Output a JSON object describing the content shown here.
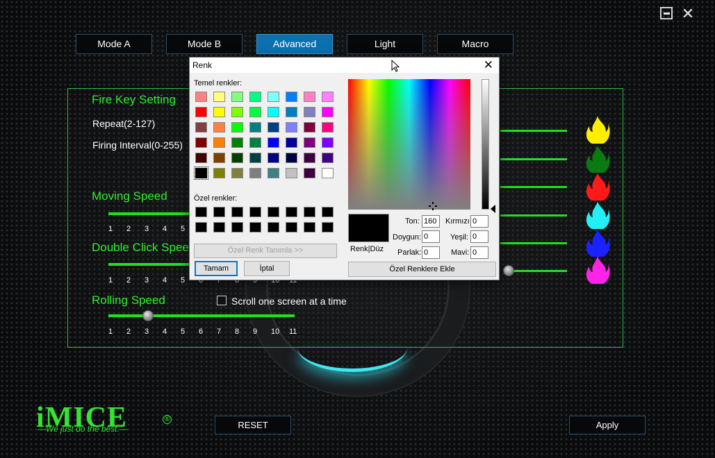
{
  "window": {
    "minimize_glyph": "",
    "close_glyph": "✕"
  },
  "tabs": [
    {
      "label": "Mode A",
      "active": false
    },
    {
      "label": "Mode B",
      "active": false
    },
    {
      "label": "Advanced",
      "active": true
    },
    {
      "label": "Light",
      "active": false
    },
    {
      "label": "Macro",
      "active": false
    }
  ],
  "panel": {
    "fire_key_title": "Fire Key Setting",
    "repeat_label": "Repeat(2-127)",
    "firing_interval_label": "Firing Interval(0-255)",
    "moving_speed_title": "Moving Speed",
    "double_click_title": "Double Click Speed",
    "rolling_speed_title": "Rolling Speed",
    "scroll_checkbox_label": "Scroll one screen at a time",
    "scroll_checked": false,
    "ticks": [
      "1",
      "2",
      "3",
      "4",
      "5",
      "6",
      "7",
      "8",
      "9",
      "10",
      "11"
    ],
    "rolling_speed_value": 3
  },
  "flame_colors": [
    "#ffee00",
    "#0a7a12",
    "#ff1a1a",
    "#22f0f5",
    "#1a22ff",
    "#ff22e8"
  ],
  "logo": {
    "brand": "iMICE",
    "registered": "®",
    "tagline": "—We just do the best.—"
  },
  "buttons": {
    "reset": "RESET",
    "apply": "Apply"
  },
  "dialog": {
    "title": "Renk",
    "close_glyph": "✕",
    "basic_colors_label": "Temel renkler:",
    "custom_colors_label": "Özel renkler:",
    "define_custom_button": "Özel Renk Tanımla >>",
    "ok_button": "Tamam",
    "cancel_button": "İptal",
    "color_solid_label": "Renk|Düz",
    "add_custom_button": "Özel Renklere Ekle",
    "hue_label": "Ton:",
    "hue_value": "160",
    "sat_label": "Doygun:",
    "sat_value": "0",
    "lum_label": "Parlak:",
    "lum_value": "0",
    "red_label": "Kırmızı:",
    "red_value": "0",
    "green_label": "Yeşil:",
    "green_value": "0",
    "blue_label": "Mavi:",
    "blue_value": "0",
    "selected_swatch_index": 40,
    "basic_colors": [
      "#ff8080",
      "#ffff80",
      "#80ff80",
      "#00ff80",
      "#80ffff",
      "#0080ff",
      "#ff80c0",
      "#ff80ff",
      "#ff0000",
      "#ffff00",
      "#80ff00",
      "#00ff40",
      "#00ffff",
      "#0080c0",
      "#8080c0",
      "#ff00ff",
      "#804040",
      "#ff8040",
      "#00ff00",
      "#008080",
      "#004080",
      "#8080ff",
      "#800040",
      "#ff0080",
      "#800000",
      "#ff8000",
      "#008000",
      "#008040",
      "#0000ff",
      "#0000a0",
      "#800080",
      "#8000ff",
      "#400000",
      "#804000",
      "#004000",
      "#004040",
      "#000080",
      "#000040",
      "#400040",
      "#400080",
      "#000000",
      "#808000",
      "#808040",
      "#808080",
      "#408080",
      "#c0c0c0",
      "#400040",
      "#ffffff"
    ],
    "custom_colors": [
      "#000000",
      "#000000",
      "#000000",
      "#000000",
      "#000000",
      "#000000",
      "#000000",
      "#000000",
      "#000000",
      "#000000",
      "#000000",
      "#000000",
      "#000000",
      "#000000",
      "#000000",
      "#000000"
    ]
  }
}
